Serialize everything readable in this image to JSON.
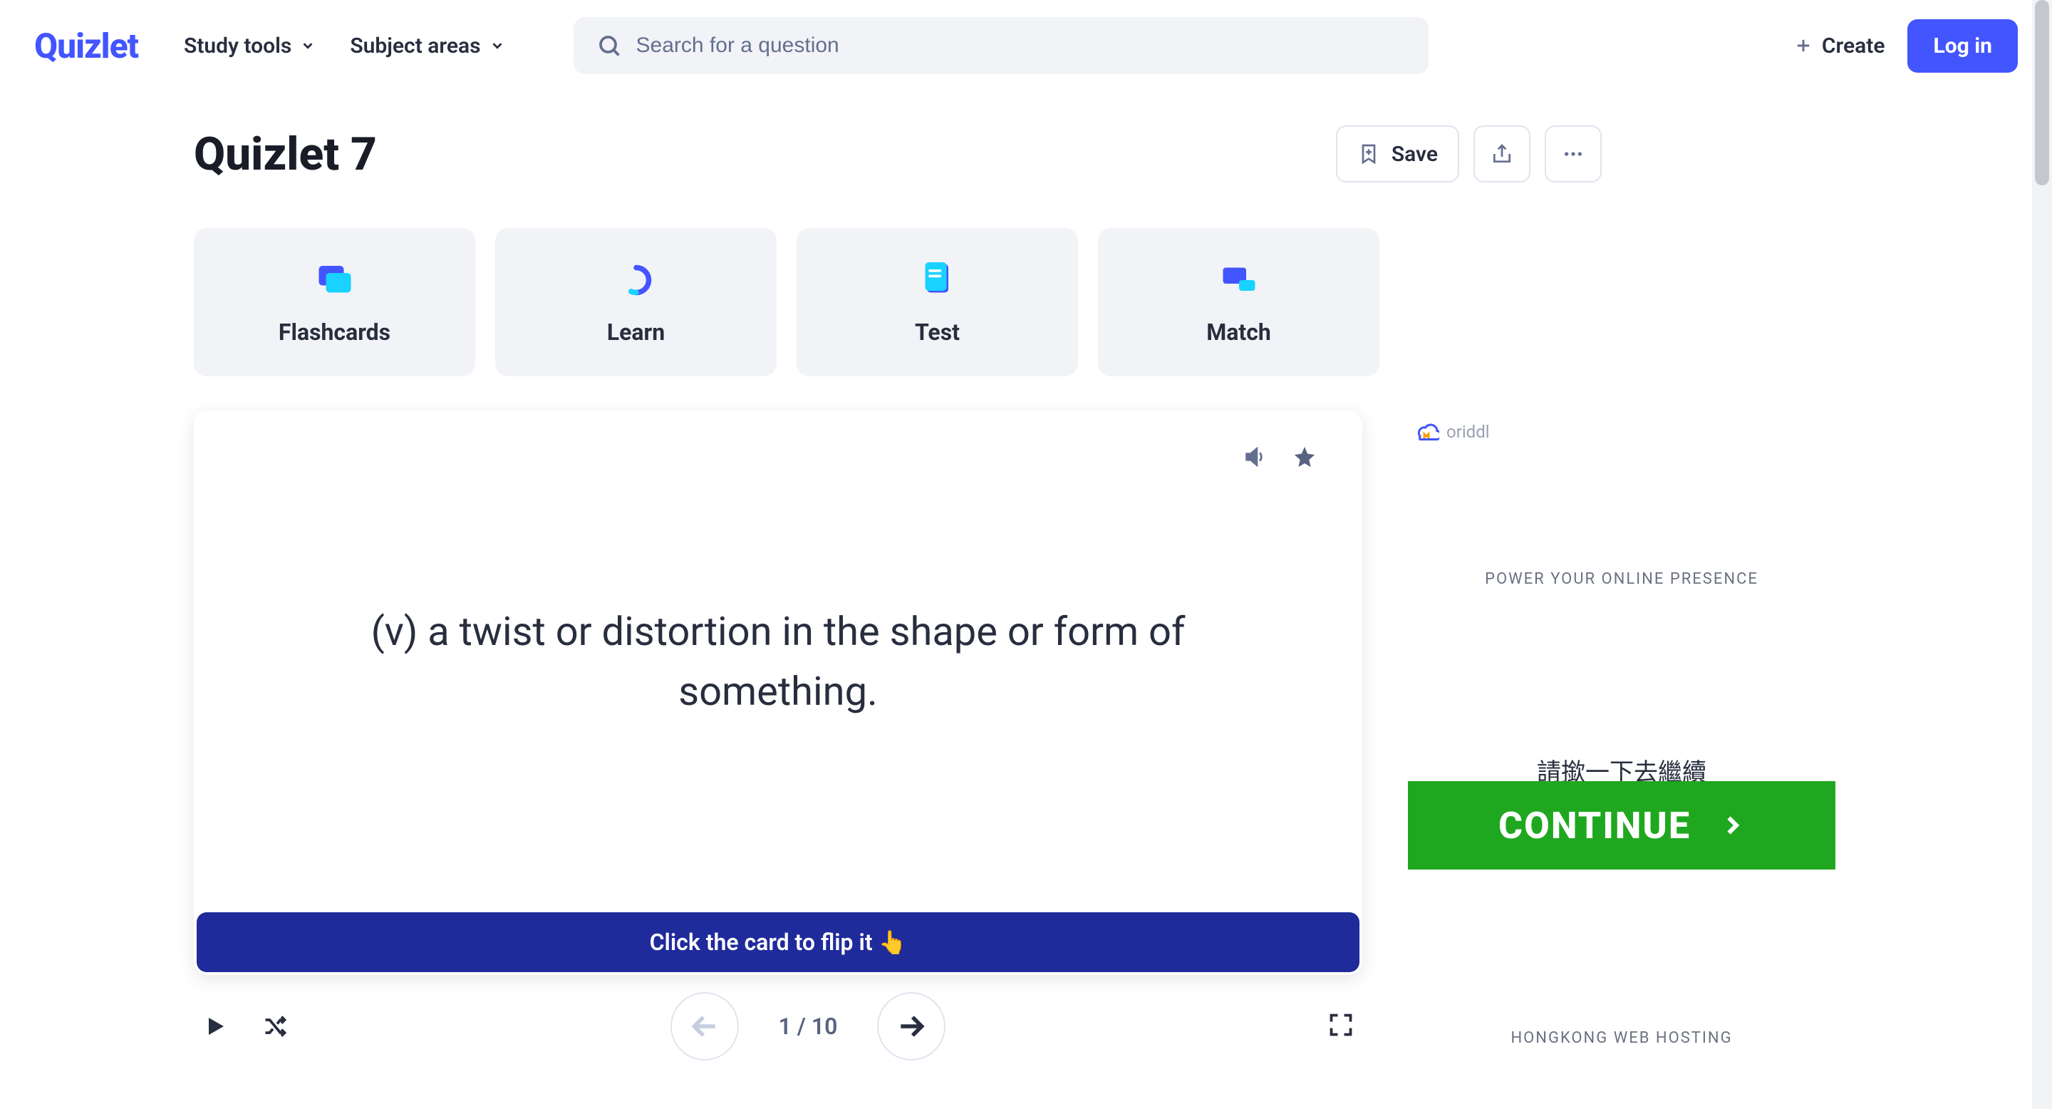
{
  "nav": {
    "logo": "Quizlet",
    "menu": {
      "study_tools": "Study tools",
      "subject_areas": "Subject areas"
    },
    "search_placeholder": "Search for a question",
    "create": "Create",
    "login": "Log in"
  },
  "page": {
    "title": "Quizlet 7",
    "save": "Save"
  },
  "modes": {
    "flashcards": "Flashcards",
    "learn": "Learn",
    "test": "Test",
    "match": "Match"
  },
  "card": {
    "text": "(v) a twist or distortion in the shape or form of something.",
    "flip_hint": "Click the card to flip it 👆",
    "counter": "1 / 10"
  },
  "ad": {
    "brand": "oriddl",
    "headline": "POWER YOUR ONLINE PRESENCE",
    "cn_prompt": "請撳一下去繼續",
    "cta": "CONTINUE",
    "footer": "HONGKONG WEB HOSTING"
  }
}
